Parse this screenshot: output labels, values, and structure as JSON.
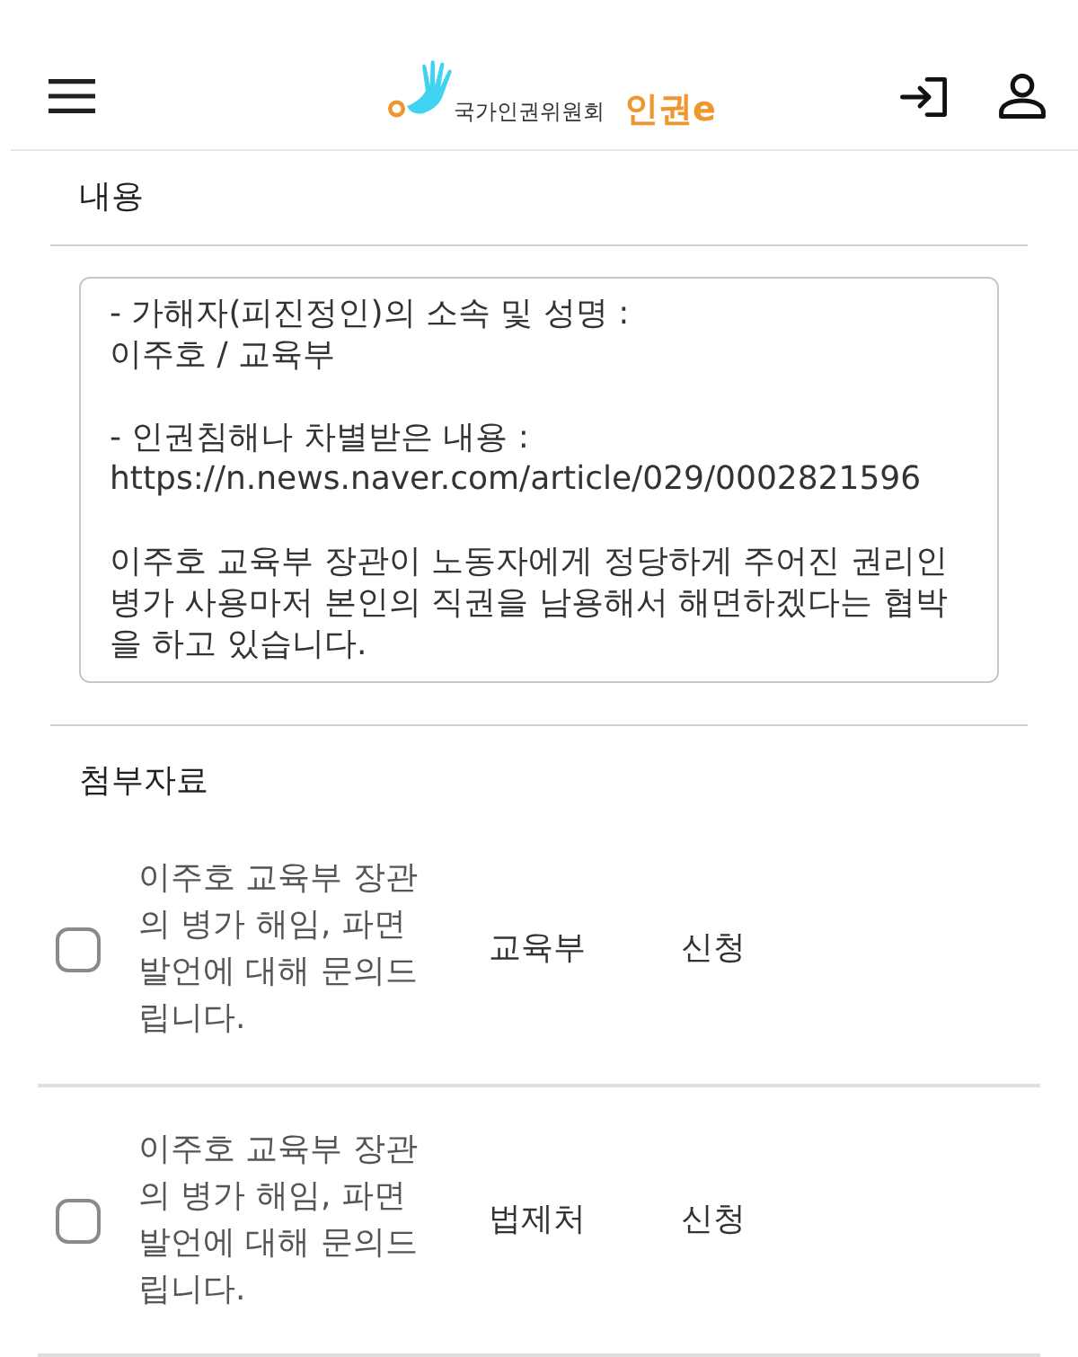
{
  "header": {
    "logo": {
      "org_name": "국가인권위원회",
      "brand": "인권e"
    }
  },
  "content": {
    "label": "내용",
    "textarea": {
      "value": "- 가해자(피진정인)의 소속 및 성명 :\n이주호 / 교육부\n\n- 인권침해나 차별받은 내용 :\nhttps://n.news.naver.com/article/029/0002821596\n\n이주호 교육부 장관이 노동자에게 정당하게 주어진 권리인 병가 사용마저 본인의 직권을 남용해서 해면하겠다는 협박을 하고 있습니다."
    }
  },
  "attachments": {
    "label": "첨부자료",
    "rows": [
      {
        "checked": false,
        "title": "이주호 교육부 장관의 병가 해임, 파면 발언에 대해 문의드립니다.",
        "agency": "교육부",
        "status": "신청"
      },
      {
        "checked": false,
        "title": "이주호 교육부 장관의 병가 해임, 파면 발언에 대해 문의드립니다.",
        "agency": "법제처",
        "status": "신청"
      }
    ]
  }
}
